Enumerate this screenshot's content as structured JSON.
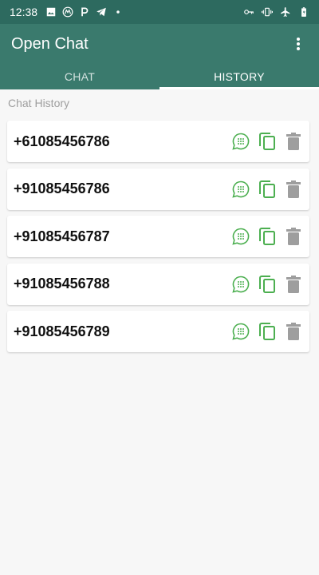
{
  "status_bar": {
    "time": "12:38",
    "left_icons": [
      "image-icon",
      "motorola-icon",
      "p-icon",
      "telegram-icon",
      "dot-icon"
    ],
    "right_icons": [
      "vpn-key-icon",
      "vibrate-icon",
      "airplane-icon",
      "battery-icon"
    ]
  },
  "app_bar": {
    "title": "Open Chat",
    "menu_icon": "more-vert-icon"
  },
  "tabs": [
    {
      "label": "CHAT",
      "active": false
    },
    {
      "label": "HISTORY",
      "active": true
    }
  ],
  "history": {
    "section_label": "Chat History",
    "items": [
      {
        "phone": "+61085456786"
      },
      {
        "phone": "+91085456786"
      },
      {
        "phone": "+91085456787"
      },
      {
        "phone": "+91085456788"
      },
      {
        "phone": "+91085456789"
      }
    ],
    "action_icons": [
      "whatsapp-icon",
      "copy-icon",
      "delete-icon"
    ]
  },
  "colors": {
    "status_bar": "#2d6a5f",
    "app_bar": "#3a7a6d",
    "accent_green": "#4caf50",
    "delete_gray": "#9e9e9e",
    "background": "#f7f7f7"
  }
}
